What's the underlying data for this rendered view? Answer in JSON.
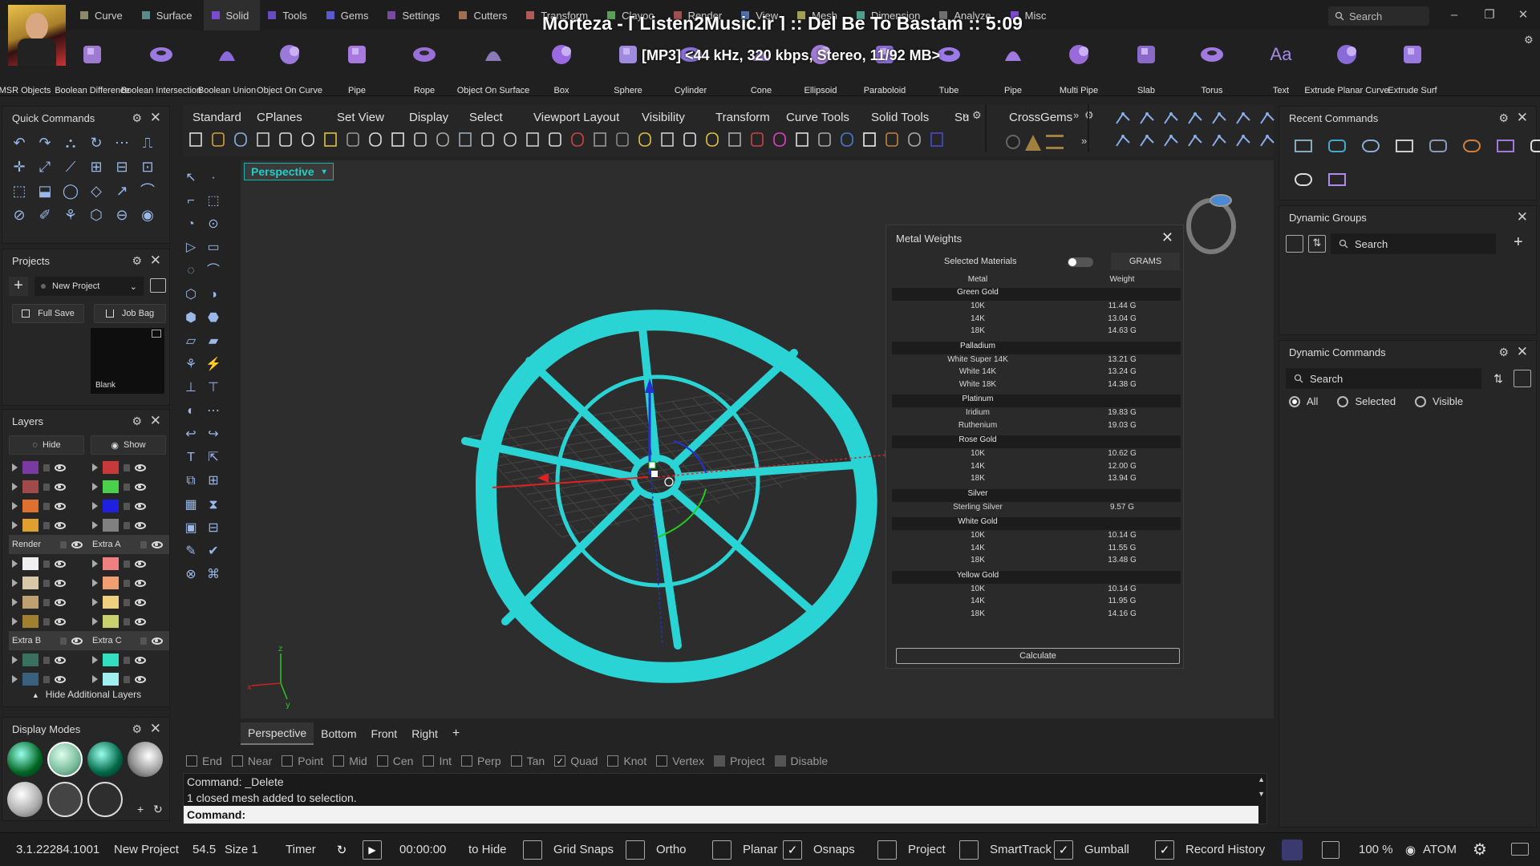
{
  "window": {
    "media_title": "Morteza - [ Listen2Music.ir ] :: Del Be To Bastam :: 5:09",
    "media_info": "[MP3] <44 kHz, 320 kbps, Stereo, 11/92 MB>",
    "search": "Search",
    "minimize": "–",
    "restore": "❐",
    "close": "✕"
  },
  "menu_tabs": [
    {
      "label": "Curve",
      "color": "#8a8a6a"
    },
    {
      "label": "Surface",
      "color": "#5a8a8a"
    },
    {
      "label": "Solid",
      "color": "#7a4ad0"
    },
    {
      "label": "Tools",
      "color": "#6a4ac0"
    },
    {
      "label": "Gems",
      "color": "#5a5ad0"
    },
    {
      "label": "Settings",
      "color": "#7a4aa0"
    },
    {
      "label": "Cutters",
      "color": "#a07050"
    },
    {
      "label": "Transform",
      "color": "#b05a5a"
    },
    {
      "label": "Clayoo",
      "color": "#5aa05a"
    },
    {
      "label": "Render",
      "color": "#a05050"
    },
    {
      "label": "View",
      "color": "#5070b0"
    },
    {
      "label": "Mesh",
      "color": "#a0a050"
    },
    {
      "label": "Dimension",
      "color": "#50a090"
    },
    {
      "label": "Analyze",
      "color": "#707070"
    },
    {
      "label": "Misc",
      "color": "#7a4ad0"
    }
  ],
  "ribbon": [
    "MSR Objects",
    "Boolean Difference",
    "Boolean Intersection",
    "Boolean Union",
    "Object On Curve",
    "Pipe",
    "Rope",
    "Object On Surface",
    "Box",
    "Sphere",
    "Cylinder",
    "Cone",
    "Ellipsoid",
    "Paraboloid",
    "Tube",
    "Pipe",
    "Multi Pipe",
    "Slab",
    "Torus",
    "Text",
    "Extrude Planar Curve",
    "Extrude Surf"
  ],
  "ribbon_text_icon": "Aa",
  "quick_commands": {
    "title": "Quick Commands"
  },
  "projects": {
    "title": "Projects",
    "add": "+",
    "dropdown": "New Project",
    "full_save": "Full Save",
    "job_bag": "Job Bag",
    "thumb_label": "Blank"
  },
  "layers": {
    "title": "Layers",
    "hide": "Hide",
    "show": "Show",
    "footer": "Hide Additional Layers",
    "rows": [
      {
        "l": {
          "color": "#7a3aa0"
        },
        "r": {
          "color": "#c83a3a"
        }
      },
      {
        "l": {
          "color": "#a04a4a"
        },
        "r": {
          "color": "#4ad04a"
        }
      },
      {
        "l": {
          "color": "#e07030"
        },
        "r": {
          "color": "#2020e0"
        }
      },
      {
        "l": {
          "color": "#e0a030"
        },
        "r": {
          "color": "#808080"
        }
      },
      {
        "l": {
          "name": "Render"
        },
        "r": {
          "name": "Extra A"
        }
      },
      {
        "l": {
          "color": "#f0f0f0"
        },
        "r": {
          "color": "#f08080"
        }
      },
      {
        "l": {
          "color": "#d8c8a8"
        },
        "r": {
          "color": "#f0a070"
        }
      },
      {
        "l": {
          "color": "#c0a070"
        },
        "r": {
          "color": "#f0d080"
        }
      },
      {
        "l": {
          "color": "#a08030"
        },
        "r": {
          "color": "#c8d070"
        }
      },
      {
        "l": {
          "name": "Extra B"
        },
        "r": {
          "name": "Extra C"
        }
      },
      {
        "l": {
          "color": "#3a7060"
        },
        "r": {
          "color": "#30e0c0"
        }
      },
      {
        "l": {
          "color": "#3a6080"
        },
        "r": {
          "color": "#a0f0f0"
        }
      }
    ]
  },
  "display_modes": {
    "title": "Display Modes",
    "add": "+",
    "refresh": "↻"
  },
  "viewport_tabs": [
    "Standard",
    "CPlanes",
    "Set View",
    "Display",
    "Select",
    "Viewport Layout",
    "Visibility",
    "Transform",
    "Curve Tools",
    "Solid Tools",
    "Su"
  ],
  "crossgems": "CrossGems",
  "more_arrows": "»",
  "viewport": {
    "label": "Perspective",
    "dropdown": "▾"
  },
  "metal_weights": {
    "title": "Metal Weights",
    "selected_materials": "Selected Materials",
    "unit": "GRAMS",
    "col_metal": "Metal",
    "col_weight": "Weight",
    "calculate": "Calculate",
    "groups": [
      {
        "name": "Green Gold",
        "items": [
          [
            "10K",
            "11.44 G"
          ],
          [
            "14K",
            "13.04 G"
          ],
          [
            "18K",
            "14.63 G"
          ]
        ]
      },
      {
        "name": "Palladium",
        "items": [
          [
            "White Super 14K",
            "13.21 G"
          ],
          [
            "White 14K",
            "13.24 G"
          ],
          [
            "White 18K",
            "14.38 G"
          ]
        ]
      },
      {
        "name": "Platinum",
        "items": [
          [
            "Iridium",
            "19.83 G"
          ],
          [
            "Ruthenium",
            "19.03 G"
          ]
        ]
      },
      {
        "name": "Rose Gold",
        "items": [
          [
            "10K",
            "10.62 G"
          ],
          [
            "14K",
            "12.00 G"
          ],
          [
            "18K",
            "13.94 G"
          ]
        ]
      },
      {
        "name": "Silver",
        "items": [
          [
            "Sterling Silver",
            "9.57 G"
          ]
        ]
      },
      {
        "name": "White Gold",
        "items": [
          [
            "10K",
            "10.14 G"
          ],
          [
            "14K",
            "11.55 G"
          ],
          [
            "18K",
            "13.48 G"
          ]
        ]
      },
      {
        "name": "Yellow Gold",
        "items": [
          [
            "10K",
            "10.14 G"
          ],
          [
            "14K",
            "11.95 G"
          ],
          [
            "18K",
            "14.16 G"
          ]
        ]
      }
    ]
  },
  "bottom_tabs": [
    "Perspective",
    "Bottom",
    "Front",
    "Right"
  ],
  "add_tab": "+",
  "osnaps": [
    {
      "label": "End",
      "checked": false
    },
    {
      "label": "Near",
      "checked": false
    },
    {
      "label": "Point",
      "checked": false
    },
    {
      "label": "Mid",
      "checked": false
    },
    {
      "label": "Cen",
      "checked": false
    },
    {
      "label": "Int",
      "checked": false
    },
    {
      "label": "Perp",
      "checked": false
    },
    {
      "label": "Tan",
      "checked": false
    },
    {
      "label": "Quad",
      "checked": true
    },
    {
      "label": "Knot",
      "checked": false
    },
    {
      "label": "Vertex",
      "checked": false
    },
    {
      "label": "Project",
      "checked": false
    },
    {
      "label": "Disable",
      "checked": false
    }
  ],
  "command": {
    "line1": "Command: _Delete",
    "line2": "1 closed mesh added to selection.",
    "prompt": "Command:"
  },
  "status": {
    "version": "3.1.22284.1001",
    "project": "New Project",
    "val1": "54.5",
    "size": "Size 1",
    "timer": "Timer",
    "time": "00:00:00",
    "to_hide": "to Hide",
    "toggles": [
      {
        "label": "Grid Snaps",
        "checked": false
      },
      {
        "label": "Ortho",
        "checked": false
      },
      {
        "label": "Planar",
        "checked": false
      },
      {
        "label": "Osnaps",
        "checked": true
      },
      {
        "label": "Project",
        "checked": false
      },
      {
        "label": "SmartTrack",
        "checked": false
      },
      {
        "label": "Gumball",
        "checked": true
      },
      {
        "label": "Record History",
        "checked": true
      }
    ],
    "zoom": "100 %",
    "user": "ATOM",
    "refresh": "↻",
    "play": "▶"
  },
  "recent_commands": {
    "title": "Recent Commands"
  },
  "dynamic_groups": {
    "title": "Dynamic Groups",
    "search": "Search",
    "add": "+"
  },
  "dynamic_commands": {
    "title": "Dynamic Commands",
    "search": "Search",
    "all": "All",
    "selected": "Selected",
    "visible": "Visible"
  },
  "colors": {
    "accent": "#1ed0c7",
    "ring": "#2ad4d4"
  },
  "icons": {
    "gear": "⚙",
    "close": "✕",
    "dropdown": "⌄",
    "up": "▲",
    "check": "✓",
    "scroll_up": "▲",
    "scroll_down": "▼"
  }
}
